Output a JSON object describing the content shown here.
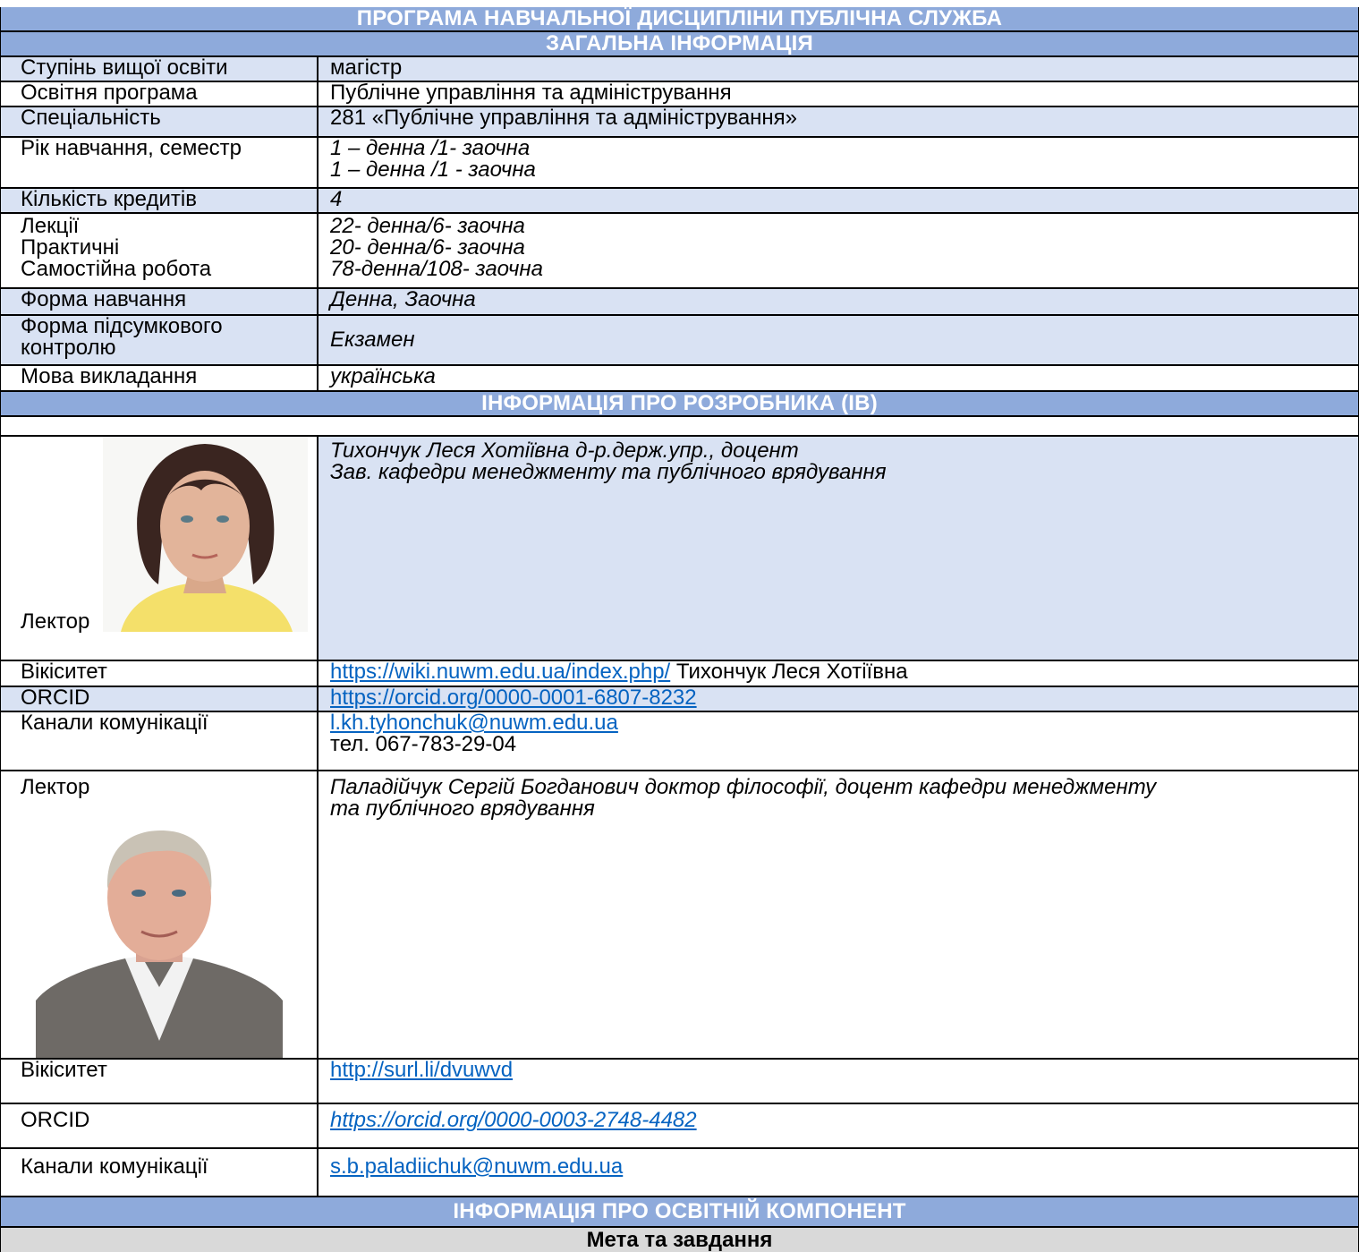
{
  "doc_title": "ПРОГРАМА НАВЧАЛЬНОЇ ДИСЦИПЛІНИ ПУБЛІЧНА СЛУЖБА",
  "general": {
    "heading": "ЗАГАЛЬНА ІНФОРМАЦІЯ",
    "degree_label": "Ступінь вищої освіти",
    "degree_value": "магістр",
    "program_label": "Освітня програма",
    "program_value": "Публічне управління та адміністрування",
    "specialty_label": "Спеціальність",
    "specialty_value": "281 «Публічне управління та адміністрування»",
    "year_label": "Рік навчання, семестр",
    "year_value_1": "1 – денна /1- заочна",
    "year_value_2": "1 – денна /1 - заочна",
    "credits_label": "Кількість кредитів",
    "credits_value": "4",
    "lectures_label": "Лекції",
    "lectures_value": "22- денна/6- заочна",
    "practice_label": "Практичні",
    "practice_value": "20- денна/6- заочна",
    "selfwork_label": "Самостійна робота",
    "selfwork_value": "78-денна/108- заочна",
    "form_label": "Форма навчання",
    "form_value": "Денна, Заочна",
    "control_label_1": "Форма підсумкового",
    "control_label_2": "контролю",
    "control_value": "Екзамен",
    "language_label": "Мова викладання",
    "language_value": "українська"
  },
  "developers": {
    "heading": "ІНФОРМАЦІЯ ПРО РОЗРОБНИКА (ІВ)",
    "lecturer1": {
      "label": "Лектор",
      "name_line": "Тихончук Леся Хотіївна д-р.держ.упр., доцент",
      "position_line": "Зав. кафедри менеджменту та публічного врядування",
      "wiki_label": "Вікіситет",
      "wiki_link": "https://wiki.nuwm.edu.ua/index.php/",
      "wiki_text": " Тихончук Леся Хотіївна",
      "orcid_label": "ORCID",
      "orcid_link": "https://orcid.org/0000-0001-6807-8232",
      "channels_label": "Канали комунікації",
      "email": "l.kh.tyhonchuk@nuwm.edu.ua",
      "phone": "тел. 067-783-29-04"
    },
    "lecturer2": {
      "label": "Лектор",
      "name_line_1": "Паладійчук Сергій Богданович доктор філософії, доцент кафедри менеджменту",
      "name_line_2": "та публічного врядування",
      "wiki_label": "Вікіситет",
      "wiki_link": "http://surl.li/dvuwvd",
      "orcid_label": "ORCID",
      "orcid_link": "https://orcid.org/0000-0003-2748-4482",
      "channels_label": "Канали комунікації",
      "email": "s.b.paladiichuk@nuwm.edu.ua"
    }
  },
  "component": {
    "heading": "ІНФОРМАЦІЯ ПРО ОСВІТНІЙ КОМПОНЕНТ",
    "subheading": "Мета та завдання"
  },
  "colors": {
    "header_bg": "#8eaadb",
    "row_blue": "#d9e2f3",
    "link": "#0563c1",
    "subheading_bg": "#d9d9d9"
  }
}
